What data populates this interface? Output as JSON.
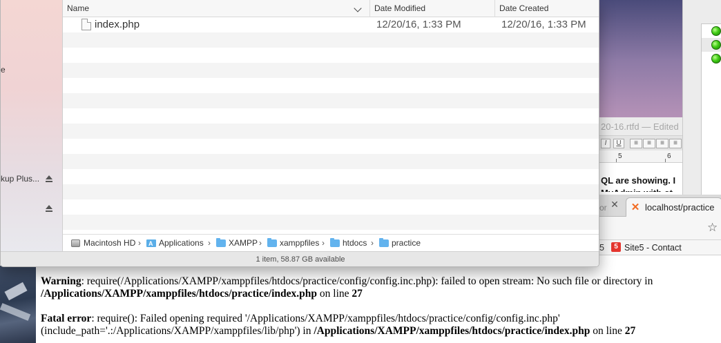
{
  "finder": {
    "sidebar": {
      "items": [
        {
          "label": "e"
        },
        {
          "label": "kup Plus..."
        }
      ]
    },
    "columns": {
      "name": "Name",
      "modified": "Date Modified",
      "created": "Date Created"
    },
    "files": [
      {
        "name": "index.php",
        "modified": "12/20/16, 1:33 PM",
        "created": "12/20/16, 1:33 PM"
      }
    ],
    "path": [
      "Macintosh HD",
      "Applications",
      "XAMPP",
      "xamppfiles",
      "htdocs",
      "practice"
    ],
    "status": "1 item, 58.87 GB available"
  },
  "textedit": {
    "title": "20-16.rtfd — Edited",
    "buttons": [
      "I",
      "U"
    ],
    "ruler": [
      "5",
      "6"
    ],
    "body_line1": "QL are showing. I",
    "body_line2": "MyAdmin with ot"
  },
  "status_panel": {
    "dot_color": "#3fcc14"
  },
  "chrome": {
    "prev_tab_fragment": "or",
    "tab_title": "localhost/practice",
    "bookmark_number": "5",
    "bookmark_icon_text": "5",
    "bookmark_label": "Site5 - Contact"
  },
  "page": {
    "warning_label": "Warning",
    "warning_text": ": require(/Applications/XAMPP/xamppfiles/htdocs/practice/config/config.inc.php): failed to open stream: No such file or directory in",
    "warning_file": "/Applications/XAMPP/xamppfiles/htdocs/practice/index.php",
    "warning_on": " on line ",
    "warning_line": "27",
    "fatal_label": "Fatal error",
    "fatal_text_1": ": require(): Failed opening required '/Applications/XAMPP/xamppfiles/htdocs/practice/config/config.inc.php'",
    "fatal_text_2": "(include_path='.:/Applications/XAMPP/xamppfiles/lib/php') in ",
    "fatal_file": "/Applications/XAMPP/xamppfiles/htdocs/practice/index.php",
    "fatal_on": " on line ",
    "fatal_line": "27"
  }
}
